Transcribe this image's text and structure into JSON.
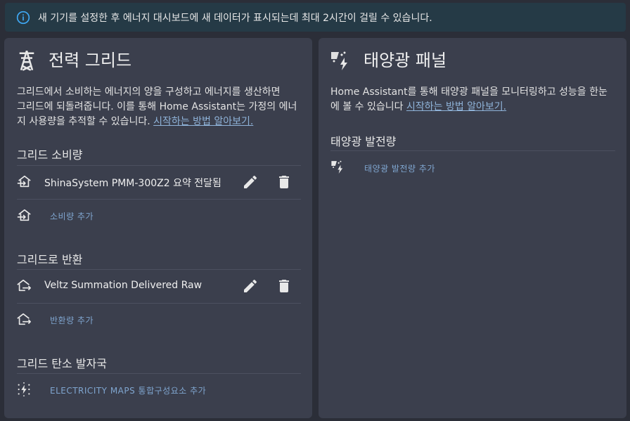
{
  "banner": {
    "icon": "info-icon",
    "text": "새 기기를 설정한 후 에너지 대시보드에 새 데이터가 표시되는데 최대 2시간이 걸릴 수 있습니다."
  },
  "grid_card": {
    "icon": "transmission-tower-icon",
    "title": "전력 그리드",
    "description_line1": "그리드에서 소비하는 에너지의 양을 구성하고 에너지를 생산하면",
    "description_line2": "그리드에 되돌려줍니다. 이를 통해 Home Assistant는 가정의 에너",
    "description_line3_prefix": "지 사용량을 추적할 수 있습니다. ",
    "learn_more_link": "시작하는 방법 알아보기.",
    "consumption": {
      "heading": "그리드 소비량",
      "source_label": "ShinaSystem PMM-300Z2 요약 전달됨",
      "add_label": "소비량 추가"
    },
    "return": {
      "heading": "그리드로 반환",
      "source_label": "Veltz Summation Delivered Raw",
      "add_label": "반환량 추가"
    },
    "carbon": {
      "heading": "그리드 탄소 발자국",
      "add_label": "ELECTRICITY MAPS 통합구성요소 추가"
    }
  },
  "solar_card": {
    "icon": "solar-power-icon",
    "title": "태양광 패널",
    "description_line1": "Home Assistant를 통해 태양광 패널을 모니터링하고 성능을 한눈",
    "description_line2_prefix": "에 볼 수 있습니다 ",
    "learn_more_link": "시작하는 방법 알아보기.",
    "production": {
      "heading": "태양광 발전량",
      "add_label": "태양광 발전량 추가"
    }
  },
  "colors": {
    "background": "#2b2e38",
    "card": "#3b3f4d",
    "banner": "#253a46",
    "info_accent": "#3fa9f5",
    "link": "#8fb3d9",
    "add_link": "#7fa5cf"
  }
}
